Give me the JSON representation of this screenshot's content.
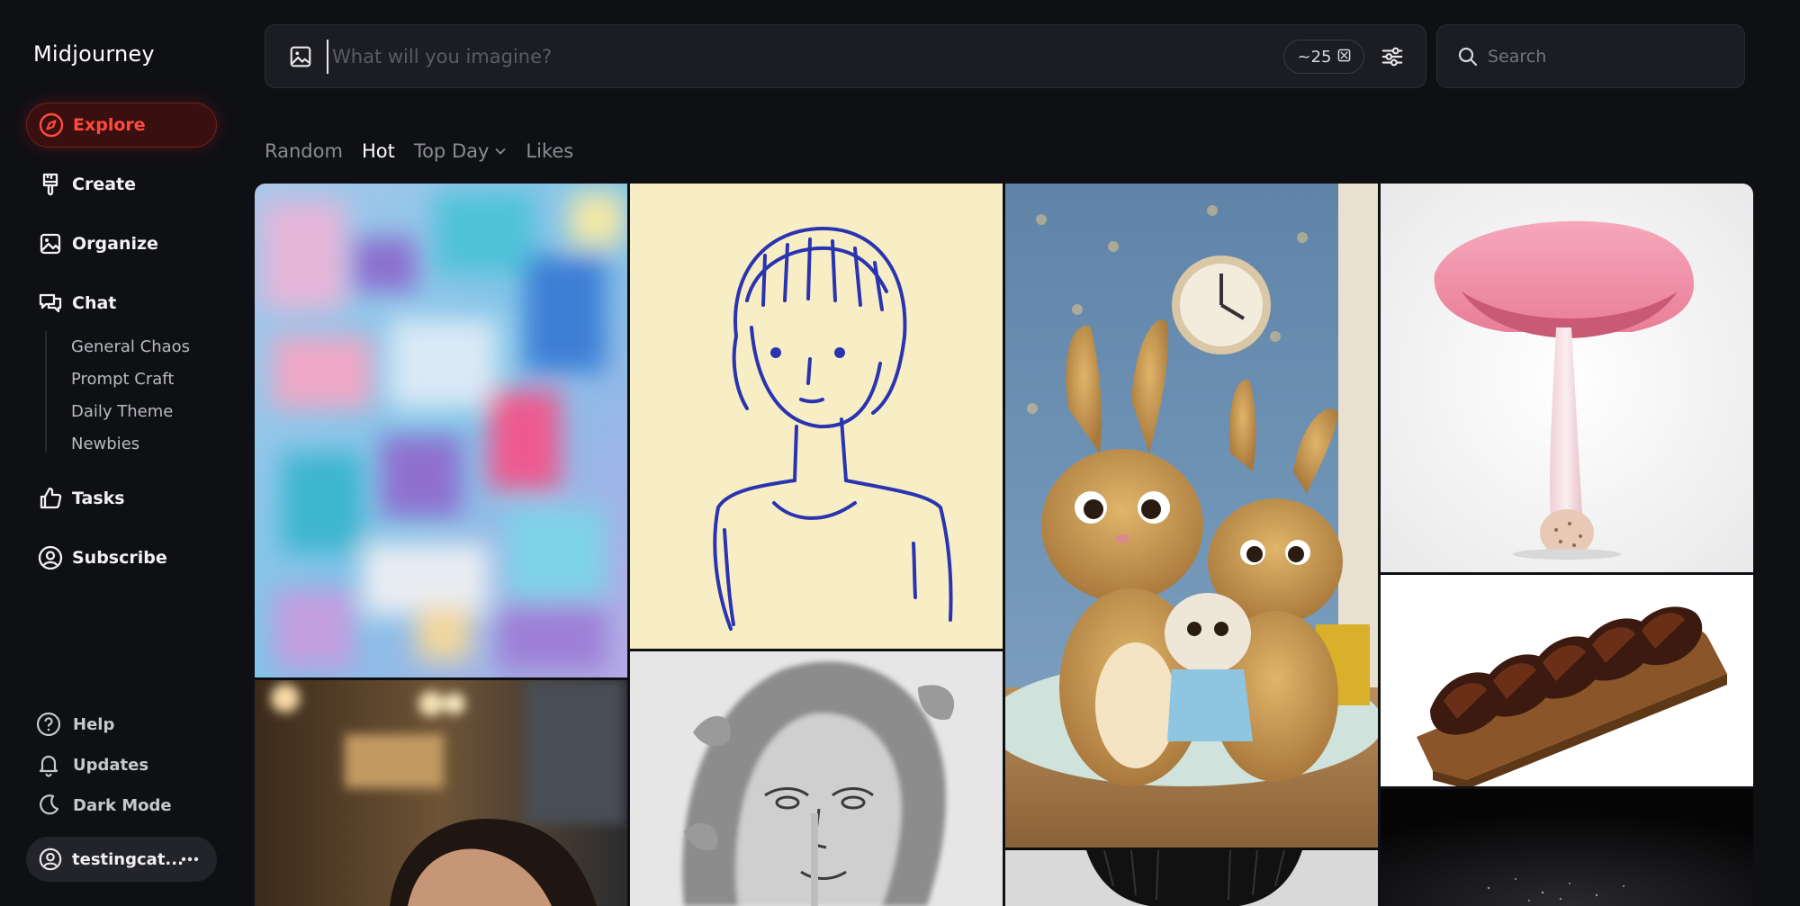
{
  "brand": "Midjourney",
  "nav": {
    "explore": "Explore",
    "create": "Create",
    "organize": "Organize",
    "chat": "Chat",
    "chat_channels": [
      "General Chaos",
      "Prompt Craft",
      "Daily Theme",
      "Newbies"
    ],
    "tasks": "Tasks",
    "subscribe": "Subscribe"
  },
  "footer": {
    "help": "Help",
    "updates": "Updates",
    "dark_mode": "Dark Mode",
    "username": "testingcat..."
  },
  "prompt": {
    "placeholder": "What will you imagine?",
    "credits": "~25"
  },
  "search": {
    "placeholder": "Search"
  },
  "tabs": [
    "Random",
    "Hot",
    "Top Day",
    "Likes"
  ],
  "active_tab": "Hot",
  "colors": {
    "accent": "#ff4a3d",
    "background": "#0f1014",
    "panel": "#1c1d22"
  },
  "gallery": [
    {
      "subject": "abstract pastel brushstroke painting"
    },
    {
      "subject": "blue ink line drawing of a girl"
    },
    {
      "subject": "cartoon rabbit family in a bedroom"
    },
    {
      "subject": "pink mushroom on white background"
    },
    {
      "subject": "sliced grilled steak on wooden board"
    },
    {
      "subject": "pencil sketch portrait with leaves"
    },
    {
      "subject": "close-up portrait with bokeh lights"
    },
    {
      "subject": "dark hair photo"
    },
    {
      "subject": "dark starry image"
    }
  ]
}
